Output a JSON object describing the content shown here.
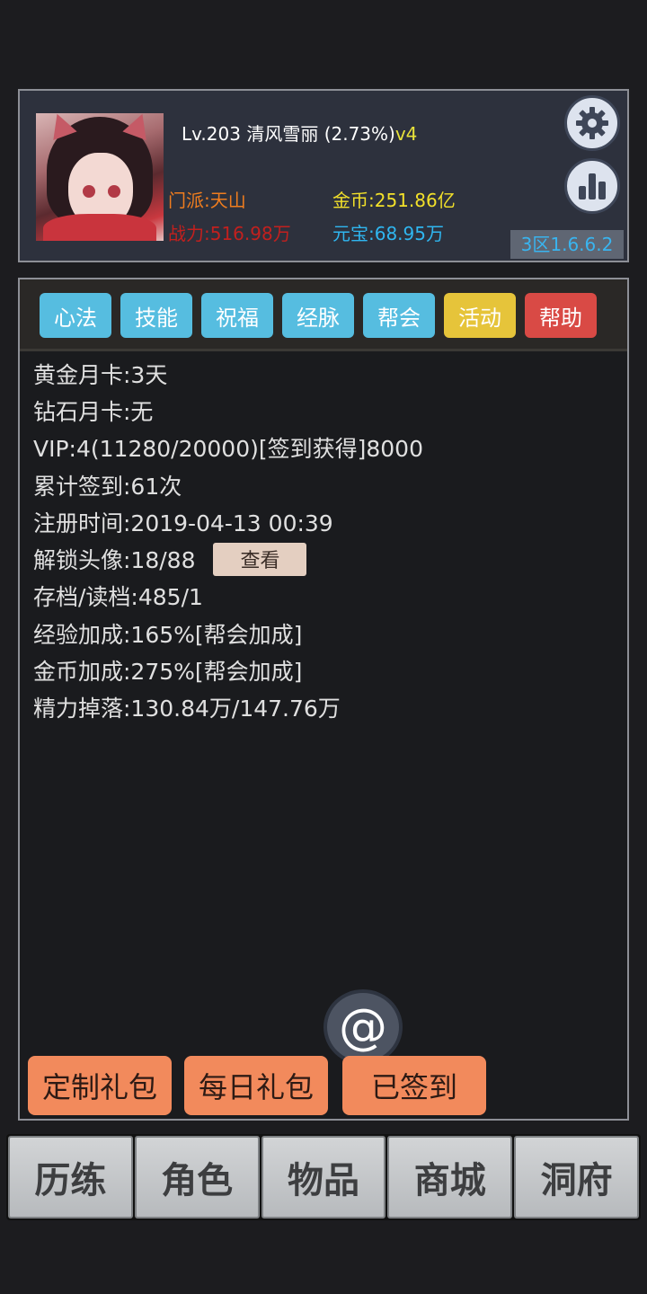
{
  "header": {
    "level": "Lv.203",
    "player_name": "清风雪丽",
    "progress": "(2.73%)",
    "vip_tag": "v4",
    "faction": "门派:天山",
    "gold": "金币:251.86亿",
    "power": "战力:516.98万",
    "ingot": "元宝:68.95万",
    "server": "3区1.6.6.2",
    "settings_icon": "gear-icon",
    "stats_icon": "bar-chart-icon"
  },
  "tabs": [
    {
      "label": "心法",
      "color": "#56bde0"
    },
    {
      "label": "技能",
      "color": "#56bde0"
    },
    {
      "label": "祝福",
      "color": "#56bde0"
    },
    {
      "label": "经脉",
      "color": "#56bde0"
    },
    {
      "label": "帮会",
      "color": "#56bde0"
    },
    {
      "label": "活动",
      "color": "#e6c43a"
    },
    {
      "label": "帮助",
      "color": "#d94a45"
    }
  ],
  "info": {
    "gold_card": "黄金月卡:3天",
    "diamond_card": "钻石月卡:无",
    "vip": "VIP:4(11280/20000)[签到获得]8000",
    "signin_total": "累计签到:61次",
    "register_time": "注册时间:2019-04-13 00:39",
    "avatars_unlocked": "解锁头像:18/88",
    "view_label": "查看",
    "save_load": "存档/读档:485/1",
    "exp_bonus": "经验加成:165%[帮会加成]",
    "gold_bonus": "金币加成:275%[帮会加成]",
    "energy_drop": "精力掉落:130.84万/147.76万"
  },
  "actions": {
    "at_symbol": "@",
    "custom_gift": "定制礼包",
    "daily_gift": "每日礼包",
    "signed_in": "已签到"
  },
  "nav": {
    "training": "历练",
    "character": "角色",
    "items": "物品",
    "shop": "商城",
    "cave": "洞府"
  }
}
